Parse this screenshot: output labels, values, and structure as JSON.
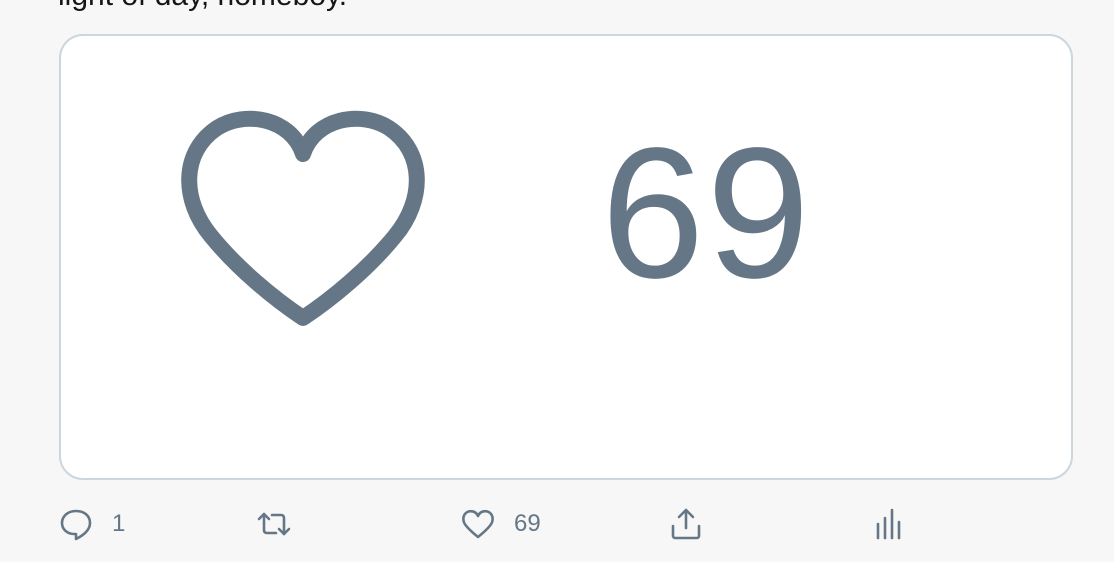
{
  "tweet": {
    "text": "light of day, homeboy."
  },
  "media": {
    "like_count": "69",
    "icon": "heart-outline-icon"
  },
  "actions": {
    "reply_count": "1",
    "retweet_count": "",
    "like_count": "69",
    "icons": {
      "reply": "reply-icon",
      "retweet": "retweet-icon",
      "like": "heart-icon",
      "share": "share-icon",
      "analytics": "analytics-icon"
    }
  },
  "colors": {
    "icon_gray": "#657786",
    "border": "#ccd6dd",
    "background": "#f7f7f7",
    "card_bg": "#ffffff"
  }
}
